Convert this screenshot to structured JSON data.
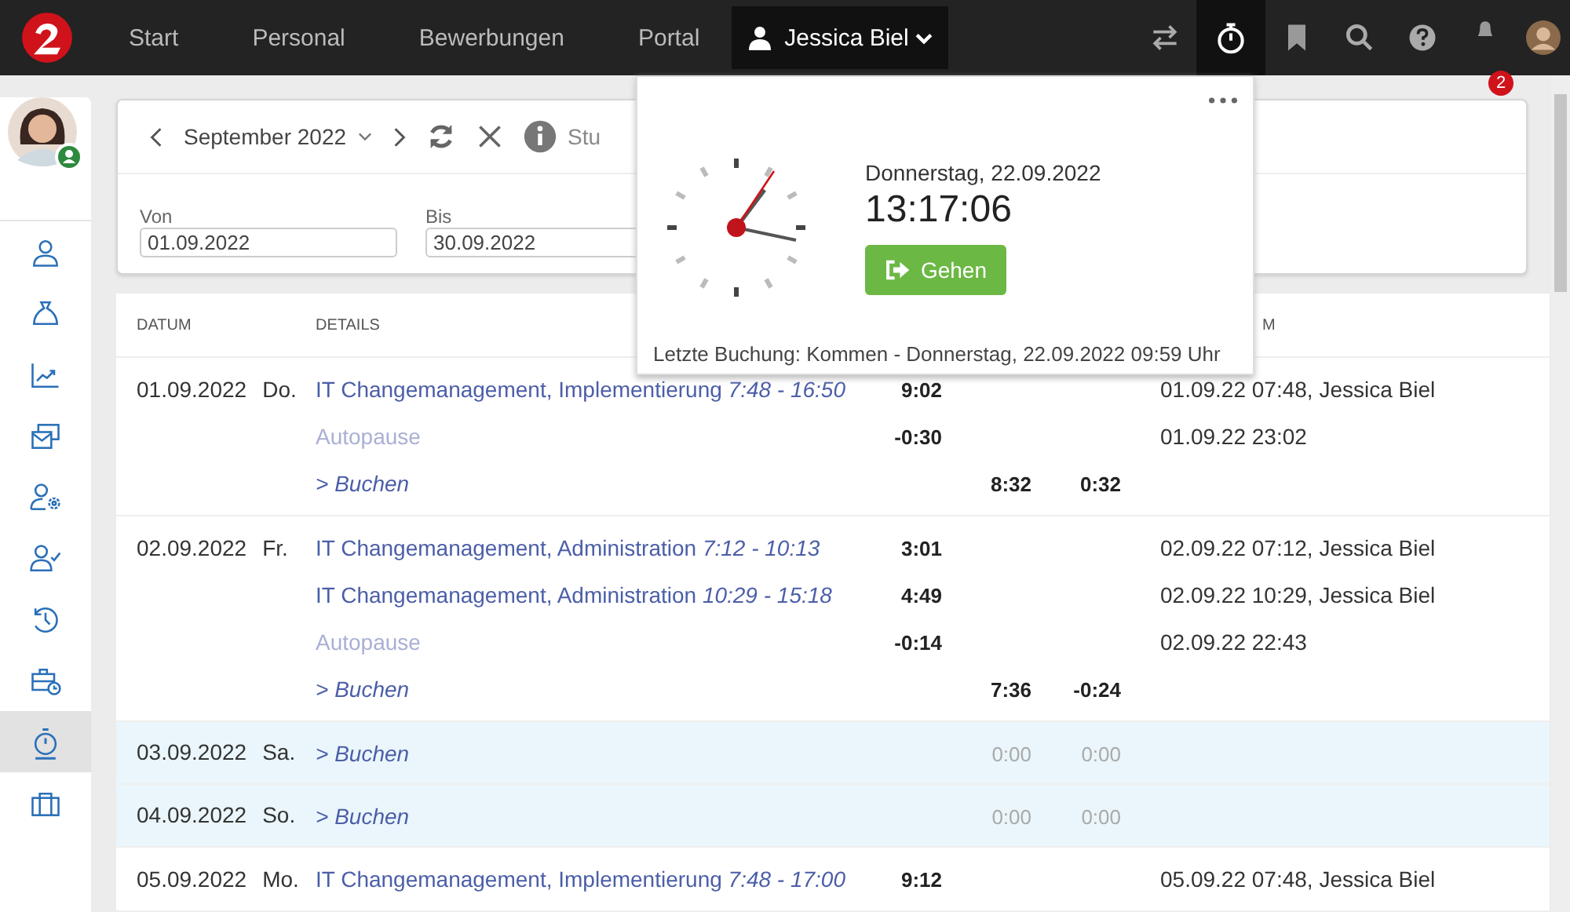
{
  "topbar": {
    "nav": [
      {
        "label": "Start"
      },
      {
        "label": "Personal"
      },
      {
        "label": "Bewerbungen"
      },
      {
        "label": "Portal"
      }
    ],
    "user_menu": {
      "label": "Jessica Biel"
    },
    "notifications_badge": "2",
    "tools": [
      {
        "kind": "swap",
        "selected": false
      },
      {
        "kind": "stopwatch",
        "selected": true
      },
      {
        "kind": "bookmark",
        "selected": false
      },
      {
        "kind": "search",
        "selected": false
      },
      {
        "kind": "help",
        "selected": false
      }
    ]
  },
  "sidebar": {
    "items": [
      {
        "kind": "person",
        "selected": false
      },
      {
        "kind": "moneybag",
        "selected": false
      },
      {
        "kind": "chart",
        "selected": false
      },
      {
        "kind": "mail",
        "selected": false
      },
      {
        "kind": "person-gear",
        "selected": false
      },
      {
        "kind": "person-check",
        "selected": false
      },
      {
        "kind": "history",
        "selected": false
      },
      {
        "kind": "case-clock",
        "selected": false
      },
      {
        "kind": "stopwatch",
        "selected": true
      },
      {
        "kind": "case",
        "selected": false
      }
    ]
  },
  "filter": {
    "period": "September 2022",
    "cut_text": "Stu",
    "from": {
      "label": "Von",
      "value": "01.09.2022"
    },
    "to": {
      "label": "Bis",
      "value": "30.09.2022"
    }
  },
  "table": {
    "columns": [
      "DATUM",
      "DETAILS",
      "M"
    ],
    "days": [
      {
        "date": "01.09.2022",
        "weekday": "Do.",
        "weekend": false,
        "lines": [
          {
            "kind": "booking",
            "text": "IT Changemanagement, Implementierung",
            "time": "7:48 - 16:50",
            "col3": "9:02",
            "audit": "01.09.22 07:48, Jessica Biel"
          },
          {
            "kind": "pause",
            "text": "Autopause",
            "col3": "-0:30",
            "audit": "01.09.22 23:02"
          },
          {
            "kind": "book",
            "text": "> Buchen",
            "col4": "8:32",
            "col5": "0:32"
          }
        ]
      },
      {
        "date": "02.09.2022",
        "weekday": "Fr.",
        "weekend": false,
        "lines": [
          {
            "kind": "booking",
            "text": "IT Changemanagement, Administration",
            "time": "7:12 - 10:13",
            "col3": "3:01",
            "audit": "02.09.22 07:12, Jessica Biel"
          },
          {
            "kind": "booking",
            "text": "IT Changemanagement, Administration",
            "time": "10:29 - 15:18",
            "col3": "4:49",
            "audit": "02.09.22 10:29, Jessica Biel"
          },
          {
            "kind": "pause",
            "text": "Autopause",
            "col3": "-0:14",
            "audit": "02.09.22 22:43"
          },
          {
            "kind": "book",
            "text": "> Buchen",
            "col4": "7:36",
            "col5": "-0:24"
          }
        ]
      },
      {
        "date": "03.09.2022",
        "weekday": "Sa.",
        "weekend": true,
        "lines": [
          {
            "kind": "book",
            "text": "> Buchen",
            "col4": "0:00",
            "col5": "0:00"
          }
        ]
      },
      {
        "date": "04.09.2022",
        "weekday": "So.",
        "weekend": true,
        "lines": [
          {
            "kind": "book",
            "text": "> Buchen",
            "col4": "0:00",
            "col5": "0:00"
          }
        ]
      },
      {
        "date": "05.09.2022",
        "weekday": "Mo.",
        "weekend": false,
        "lines": [
          {
            "kind": "booking",
            "text": "IT Changemanagement, Implementierung",
            "time": "7:48 - 17:00",
            "col3": "9:12",
            "audit": "05.09.22 07:48, Jessica Biel"
          }
        ]
      }
    ]
  },
  "clock_popup": {
    "date": "Donnerstag, 22.09.2022",
    "time": "13:17:06",
    "button": "Gehen",
    "last_booking": "Letzte Buchung: Kommen - Donnerstag, 22.09.2022 09:59 Uhr"
  }
}
